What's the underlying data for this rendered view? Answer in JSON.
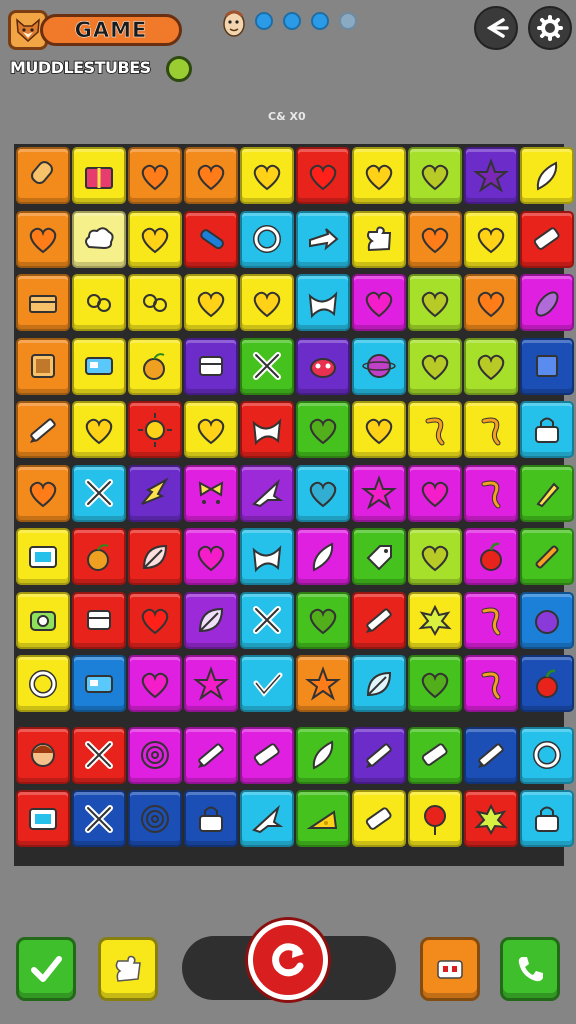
{
  "header": {
    "title": "GAME",
    "subtitle": "MUDDLESTUBES",
    "level_label": "C& X0",
    "avatar_icon": "fox-face-icon",
    "mascot_icon": "mascot-face-icon",
    "progress": {
      "filled": 3,
      "total": 4
    },
    "buttons": [
      {
        "name": "back-button",
        "icon": "back-arrow-icon"
      },
      {
        "name": "settings-button",
        "icon": "gear-icon"
      }
    ]
  },
  "colors": {
    "orange": "#f28a1c",
    "yellow": "#f8e81a",
    "paleyellow": "#f5f08a",
    "red": "#e8231c",
    "green": "#45c21e",
    "lime": "#a6e02a",
    "blue": "#1c7fd8",
    "darkblue": "#1b4fb5",
    "cyan": "#26c1ea",
    "purple": "#6b2cc9",
    "magenta": "#e020e0",
    "violet": "#9c2ad9"
  },
  "board": {
    "rows": 11,
    "cols": 10,
    "tiles": [
      [
        "orange:popsicle",
        "yellow:gift",
        "orange:heart",
        "orange:heart",
        "yellow:heart",
        "red:heart",
        "yellow:heart",
        "lime:heart",
        "purple:star",
        "yellow:feather"
      ],
      [
        "orange:heart",
        "paleyellow:cloud",
        "yellow:heart",
        "red:tube",
        "cyan:ring",
        "cyan:arrow",
        "yellow:puzzle",
        "orange:heart",
        "yellow:heart",
        "red:eraser"
      ],
      [
        "orange:chest",
        "yellow:knot",
        "yellow:knot",
        "yellow:heart",
        "yellow:heart",
        "cyan:ribbon",
        "magenta:heart",
        "lime:heart",
        "orange:heart",
        "magenta:eggplant"
      ],
      [
        "orange:frame",
        "yellow:card",
        "yellow:fruit",
        "purple:box",
        "green:cross",
        "purple:crab",
        "cyan:planet",
        "lime:heart",
        "lime:heart",
        "darkblue:square"
      ],
      [
        "orange:pencil",
        "yellow:heart",
        "red:sun",
        "yellow:heart",
        "red:ribbon",
        "green:heart",
        "yellow:heart",
        "yellow:hook",
        "yellow:hook",
        "cyan:lock"
      ],
      [
        "orange:heart",
        "cyan:cross",
        "purple:spark",
        "magenta:bow",
        "violet:plane",
        "cyan:heart",
        "magenta:star",
        "magenta:heart",
        "magenta:hook",
        "green:rocket"
      ],
      [
        "yellow:screen",
        "red:fruit",
        "red:leaf",
        "magenta:heart",
        "cyan:ribbon",
        "magenta:feather",
        "green:tag",
        "lime:heart",
        "magenta:apple",
        "green:tool"
      ],
      [
        "yellow:camera",
        "red:box",
        "red:heart",
        "violet:leaf",
        "cyan:cross",
        "green:heart",
        "red:pencil",
        "yellow:splash",
        "magenta:hook",
        "blue:berry"
      ],
      [
        "yellow:ring",
        "blue:card",
        "magenta:heart",
        "magenta:star",
        "cyan:check",
        "orange:star",
        "cyan:leaf",
        "green:heart",
        "magenta:hook",
        "darkblue:apple"
      ],
      [
        "red:girl",
        "red:cross",
        "magenta:spiral",
        "magenta:pencil",
        "magenta:eraser",
        "green:feather",
        "purple:pencil",
        "green:eraser",
        "darkblue:pencil",
        "cyan:ring"
      ],
      [
        "red:screen",
        "darkblue:cross",
        "darkblue:spiral",
        "darkblue:lock",
        "cyan:plane",
        "green:cheese",
        "yellow:eraser",
        "yellow:balloon",
        "red:splash",
        "cyan:lock"
      ]
    ]
  },
  "bottom_bar": {
    "buttons": [
      {
        "name": "confirm-button",
        "icon": "check-icon",
        "color": "#3fbf2c"
      },
      {
        "name": "hint-button",
        "icon": "puzzle-icon",
        "color": "#f8e81a"
      },
      {
        "name": "restart-button",
        "icon": "restart-icon",
        "color": "#d81e1e"
      },
      {
        "name": "video-button",
        "icon": "camera-icon",
        "color": "#f28a1c"
      },
      {
        "name": "call-button",
        "icon": "phone-icon",
        "color": "#3fbf2c"
      }
    ]
  }
}
